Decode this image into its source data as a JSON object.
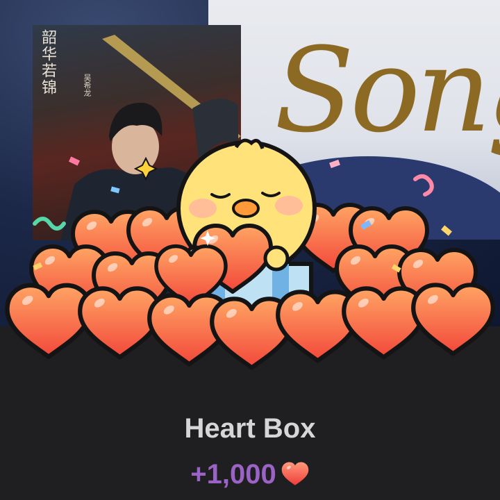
{
  "background": {
    "cover_title": "韶华若锦",
    "cover_subtitle": "吴希龙",
    "script_text": "Song"
  },
  "gift": {
    "name": "Heart Box",
    "reward": "+1,000",
    "icon": "heart-icon",
    "colors": {
      "heart_top": "#ff9a5c",
      "heart_bottom": "#f04a3a",
      "outline": "#141414",
      "chick": "#ffe27a",
      "reward_text": "#9b63c5"
    }
  }
}
